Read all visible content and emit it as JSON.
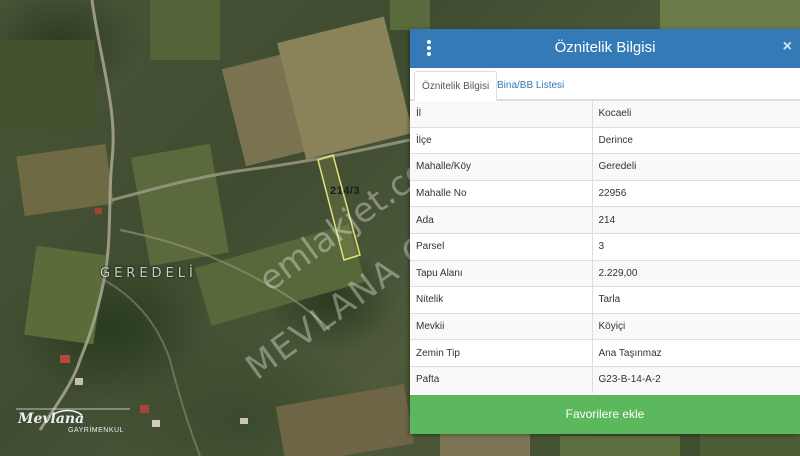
{
  "map": {
    "parcel_label": "214/3",
    "village_label": "GEREDELİ",
    "watermark_top": "emlakjet.com",
    "watermark_bottom": "MEVLANA GAYRİMENKUL",
    "logo_brand": "Mevlana",
    "logo_sub": "GAYRİMENKUL"
  },
  "panel": {
    "title": "Öznitelik Bilgisi",
    "close_glyph": "×",
    "tabs": [
      {
        "label": "Öznitelik Bilgisi",
        "active": true
      },
      {
        "label": "Bina/BB Listesi",
        "active": false
      }
    ],
    "rows": [
      {
        "key": "İl",
        "value": "Kocaeli"
      },
      {
        "key": "İlçe",
        "value": "Derince"
      },
      {
        "key": "Mahalle/Köy",
        "value": "Geredeli"
      },
      {
        "key": "Mahalle No",
        "value": "22956"
      },
      {
        "key": "Ada",
        "value": "214"
      },
      {
        "key": "Parsel",
        "value": "3"
      },
      {
        "key": "Tapu Alanı",
        "value": "2.229,00"
      },
      {
        "key": "Nitelik",
        "value": "Tarla"
      },
      {
        "key": "Mevkii",
        "value": "Köyiçi"
      },
      {
        "key": "Zemin Tip",
        "value": "Ana Taşınmaz"
      },
      {
        "key": "Pafta",
        "value": "G23-B-14-A-2"
      }
    ],
    "favorite_button": "Favorilere ekle"
  },
  "colors": {
    "header": "#337ab7",
    "favorite": "#5cb85c"
  },
  "icons": {
    "menu": "kebab-menu-icon",
    "close": "close-icon"
  }
}
